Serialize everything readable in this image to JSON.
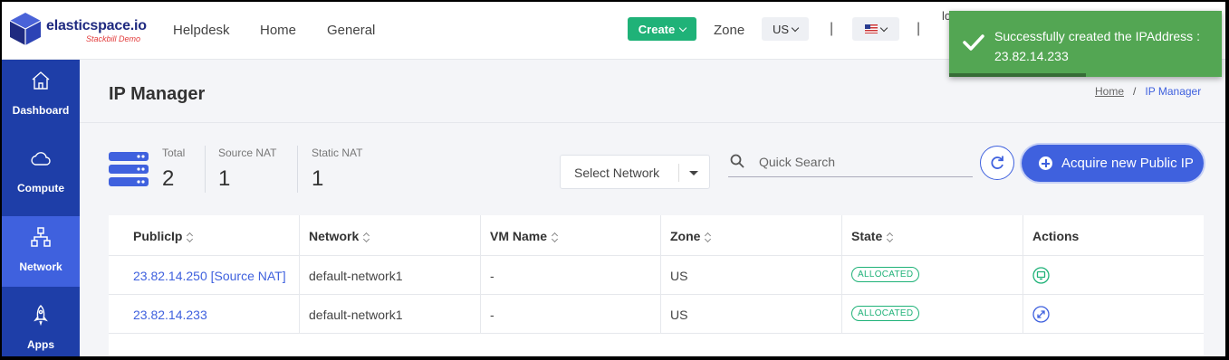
{
  "brand": {
    "name": "elasticspace.io",
    "subtitle": "Stackbill Demo"
  },
  "nav": {
    "links": [
      "Helpdesk",
      "Home",
      "General"
    ]
  },
  "topbar": {
    "create_label": "Create",
    "zone_label": "Zone",
    "zone_value": "US",
    "separator": "|",
    "user_text": "lo"
  },
  "toast": {
    "message": "Successfully created the IPAddress : 23.82.14.233",
    "color": "#53a653",
    "progress": 0.5
  },
  "sidebar": {
    "items": [
      {
        "label": "Dashboard",
        "icon": "home-icon",
        "active": false
      },
      {
        "label": "Compute",
        "icon": "cloud-icon",
        "active": false
      },
      {
        "label": "Network",
        "icon": "network-icon",
        "active": true
      },
      {
        "label": "Apps",
        "icon": "rocket-icon",
        "active": false
      }
    ]
  },
  "page": {
    "title": "IP Manager",
    "breadcrumb": {
      "home": "Home",
      "separator": "/",
      "current": "IP Manager"
    }
  },
  "stats": [
    {
      "label": "Total",
      "value": "2"
    },
    {
      "label": "Source NAT",
      "value": "1"
    },
    {
      "label": "Static NAT",
      "value": "1"
    }
  ],
  "filters": {
    "network_select": "Select Network",
    "search_placeholder": "Quick Search",
    "acquire_label": "Acquire new Public IP"
  },
  "table": {
    "columns": [
      "PublicIp",
      "Network",
      "VM Name",
      "Zone",
      "State",
      "Actions"
    ],
    "rows": [
      {
        "public_ip": "23.82.14.250 [Source NAT]",
        "network": "default-network1",
        "vm_name": "-",
        "zone": "US",
        "state": "ALLOCATED",
        "action_icon": "console-icon"
      },
      {
        "public_ip": "23.82.14.233",
        "network": "default-network1",
        "vm_name": "-",
        "zone": "US",
        "state": "ALLOCATED",
        "action_icon": "expand-icon"
      }
    ]
  },
  "colors": {
    "accent": "#3f61de",
    "sidebar": "#1e3ea8",
    "success": "#1fb278"
  }
}
